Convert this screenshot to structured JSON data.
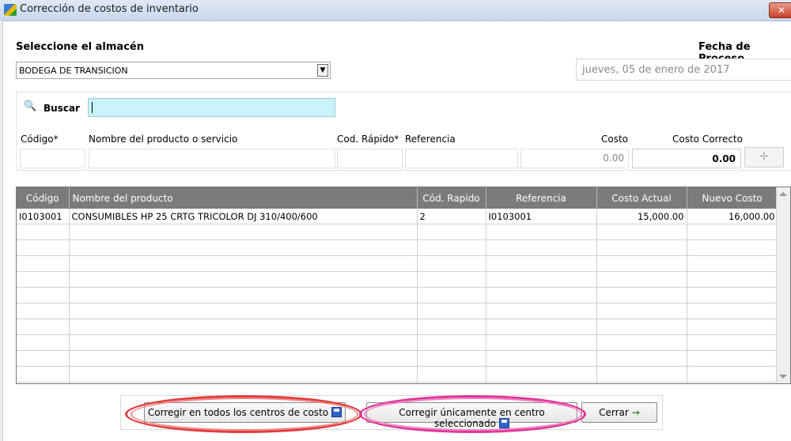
{
  "window": {
    "title": "Corrección de costos de inventario",
    "close_glyph": "✕"
  },
  "warehouse": {
    "label": "Seleccione el almacén",
    "selected": "BODEGA DE TRANSICION"
  },
  "process_date": {
    "label": "Fecha de Proceso",
    "value": "jueves, 05 de enero de 2017"
  },
  "search": {
    "label": "Buscar",
    "value": ""
  },
  "entry": {
    "codigo_label": "Código*",
    "nombre_label": "Nombre del producto o servicio",
    "cod_rapido_label": "Cod. Rápido*",
    "referencia_label": "Referencia",
    "costo_label": "Costo",
    "costo_correcto_label": "Costo Correcto",
    "costo_value": "0.00",
    "costo_correcto_value": "0.00",
    "add_glyph": "✢"
  },
  "grid": {
    "columns": [
      "Código",
      "Nombre del producto",
      "Cód. Rapido",
      "Referencia",
      "Costo Actual",
      "Nuevo Costo"
    ],
    "rows": [
      {
        "codigo": "I0103001",
        "nombre": "CONSUMIBLES HP 25 CRTG TRICOLOR DJ 310/400/600",
        "cod_rapido": "2",
        "referencia": "I0103001",
        "costo_actual": "15,000.00",
        "nuevo_costo": "16,000.00"
      }
    ]
  },
  "buttons": {
    "correct_all": "Corregir en todos los centros de costo",
    "correct_selected": "Corregir únicamente en centro seleccionado",
    "close": "Cerrar"
  },
  "colors": {
    "search_bg": "#c9f3fb",
    "grid_header": "#7b7b7b",
    "highlight_red": "#e23b3b",
    "highlight_magenta": "#e0359a"
  }
}
